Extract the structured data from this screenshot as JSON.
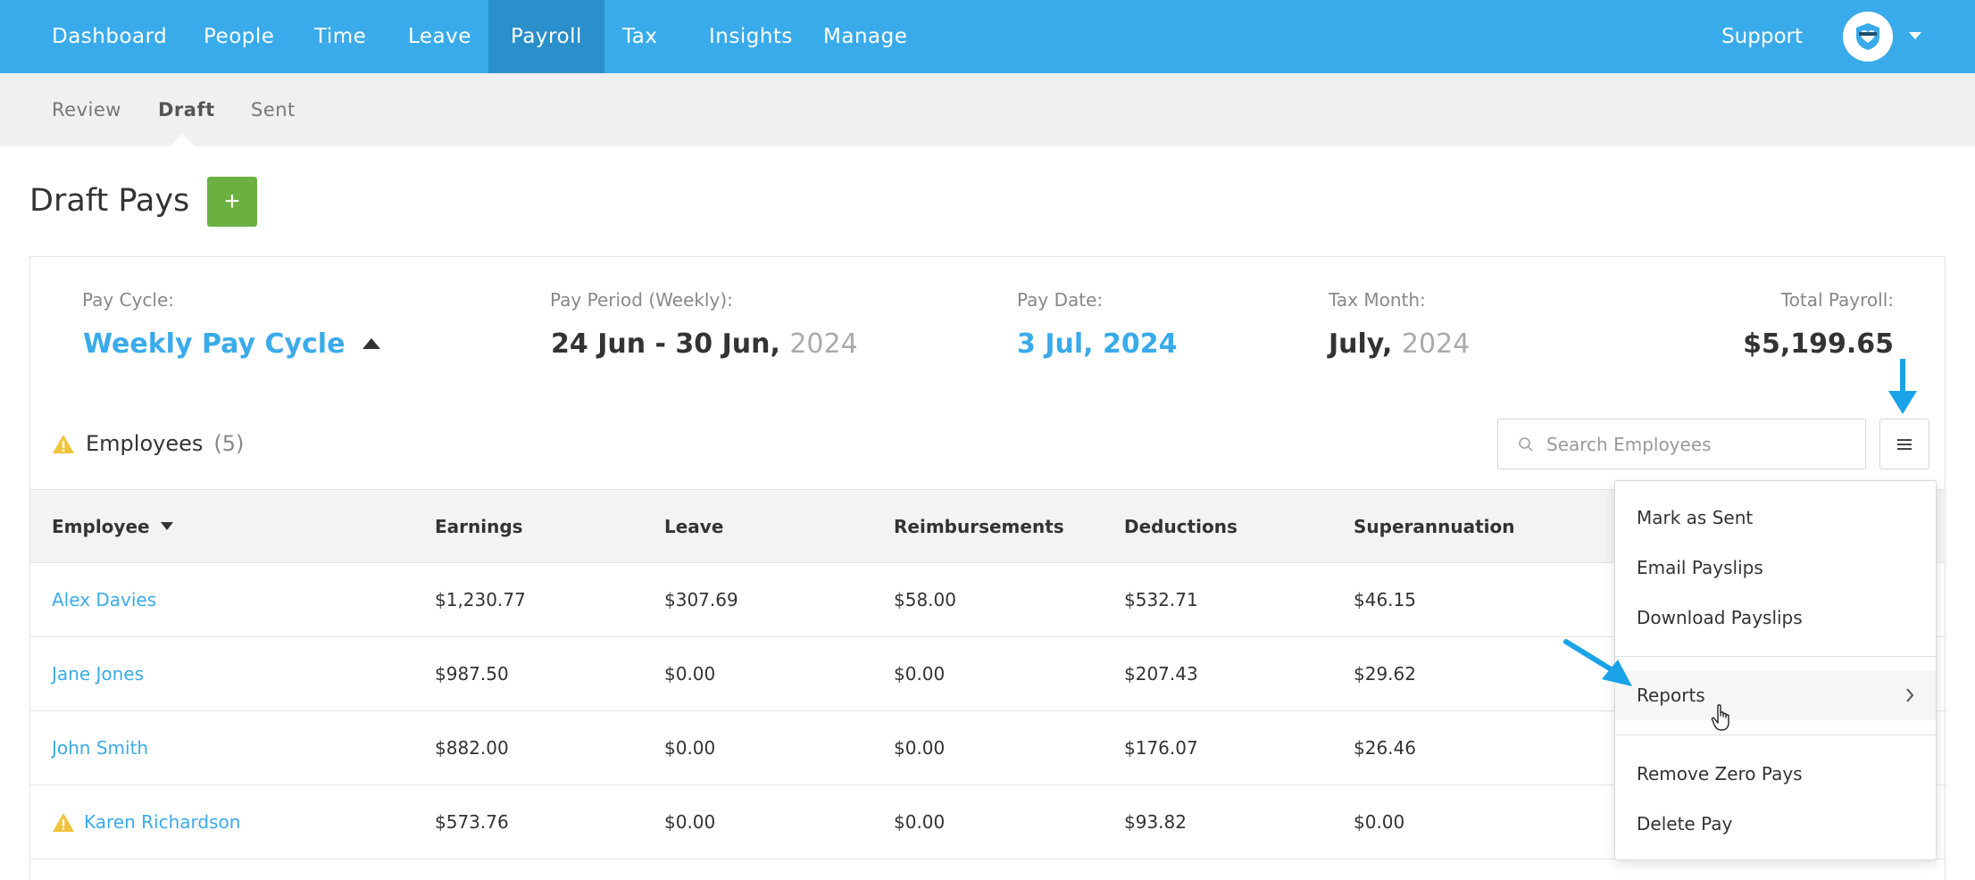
{
  "nav": {
    "items": [
      {
        "label": "Dashboard"
      },
      {
        "label": "People"
      },
      {
        "label": "Time"
      },
      {
        "label": "Leave"
      },
      {
        "label": "Payroll"
      },
      {
        "label": "Tax"
      },
      {
        "label": "Insights"
      },
      {
        "label": "Manage"
      }
    ],
    "active": "Payroll",
    "support": "Support"
  },
  "subnav": {
    "items": [
      {
        "label": "Review"
      },
      {
        "label": "Draft"
      },
      {
        "label": "Sent"
      }
    ],
    "active": "Draft"
  },
  "page": {
    "title": "Draft Pays",
    "add_label": "+"
  },
  "summary": {
    "pay_cycle_label": "Pay Cycle:",
    "pay_cycle_value": "Weekly Pay Cycle",
    "pay_period_label": "Pay Period (Weekly):",
    "pay_period_range": "24 Jun - 30 Jun,",
    "pay_period_year": "2024",
    "pay_date_label": "Pay Date:",
    "pay_date_value": "3 Jul, 2024",
    "tax_month_label": "Tax Month:",
    "tax_month_value": "July,",
    "tax_month_year": "2024",
    "total_label": "Total Payroll:",
    "total_value": "$5,199.65"
  },
  "employees": {
    "heading": "Employees",
    "count": "(5)",
    "search_placeholder": "Search Employees",
    "columns": [
      "Employee",
      "Earnings",
      "Leave",
      "Reimbursements",
      "Deductions",
      "Superannuation"
    ],
    "rows": [
      {
        "name": "Alex Davies",
        "earnings": "$1,230.77",
        "leave": "$307.69",
        "reimb": "$58.00",
        "deductions": "$532.71",
        "super": "$46.15",
        "warning": false
      },
      {
        "name": "Jane Jones",
        "earnings": "$987.50",
        "leave": "$0.00",
        "reimb": "$0.00",
        "deductions": "$207.43",
        "super": "$29.62",
        "warning": false
      },
      {
        "name": "John Smith",
        "earnings": "$882.00",
        "leave": "$0.00",
        "reimb": "$0.00",
        "deductions": "$176.07",
        "super": "$26.46",
        "warning": false
      },
      {
        "name": "Karen Richardson",
        "earnings": "$573.76",
        "leave": "$0.00",
        "reimb": "$0.00",
        "deductions": "$93.82",
        "super": "$0.00",
        "warning": true
      }
    ]
  },
  "menu": {
    "items": [
      {
        "label": "Mark as Sent"
      },
      {
        "label": "Email Payslips"
      },
      {
        "label": "Download Payslips"
      },
      {
        "label": "Reports"
      },
      {
        "label": "Remove Zero Pays"
      },
      {
        "label": "Delete Pay"
      }
    ]
  },
  "icons": {
    "avatar": "shield-heart-icon",
    "search": "search-icon",
    "menu": "hamburger-icon",
    "warning": "warning-icon",
    "chevron": "chevron-right-icon",
    "cursor": "hand-pointer-icon",
    "annotation": "blue-arrow-icon"
  },
  "colors": {
    "brand": "#3aabea",
    "nav_active": "#2a8fcb",
    "add_button": "#6cb042",
    "warning": "#f0c33c"
  }
}
